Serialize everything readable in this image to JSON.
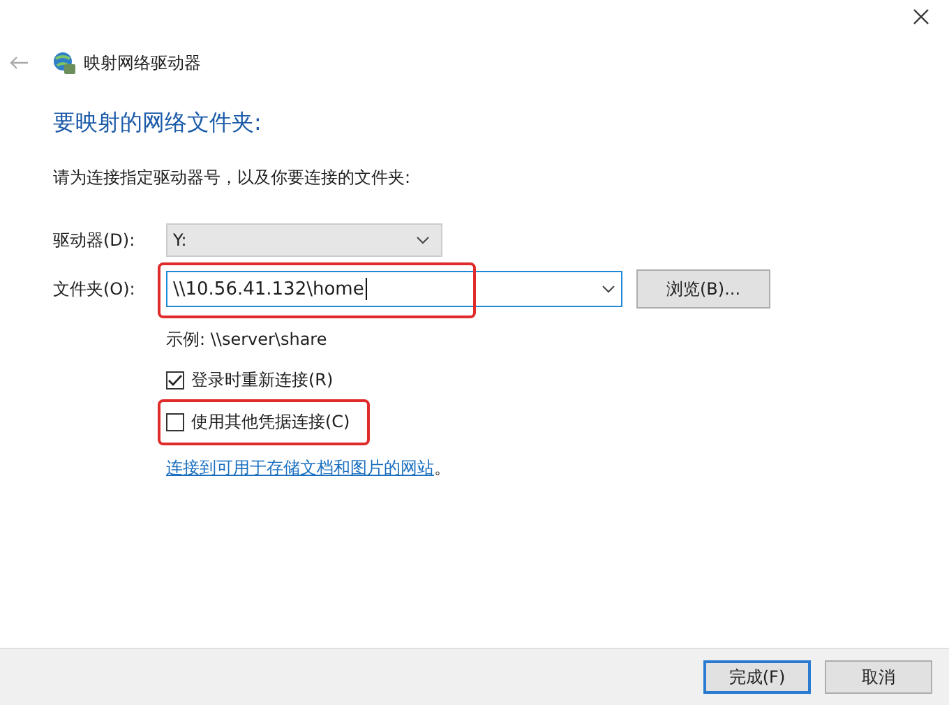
{
  "window": {
    "title": "映射网络驱动器"
  },
  "heading": "要映射的网络文件夹:",
  "instruction": "请为连接指定驱动器号，以及你要连接的文件夹:",
  "drive": {
    "label": "驱动器(D):",
    "value": "Y:"
  },
  "folder": {
    "label": "文件夹(O):",
    "value": "\\\\10.56.41.132\\home",
    "highlighted": true
  },
  "browse_button": "浏览(B)...",
  "example": "示例: \\\\server\\share",
  "options": [
    {
      "label": "登录时重新连接(R)",
      "checked": true,
      "highlighted": false
    },
    {
      "label": "使用其他凭据连接(C)",
      "checked": false,
      "highlighted": true
    }
  ],
  "link": {
    "text": "连接到可用于存储文档和图片的网站",
    "suffix": "。"
  },
  "buttons": [
    {
      "label": "完成(F)",
      "default": true
    },
    {
      "label": "取消",
      "default": false
    }
  ]
}
